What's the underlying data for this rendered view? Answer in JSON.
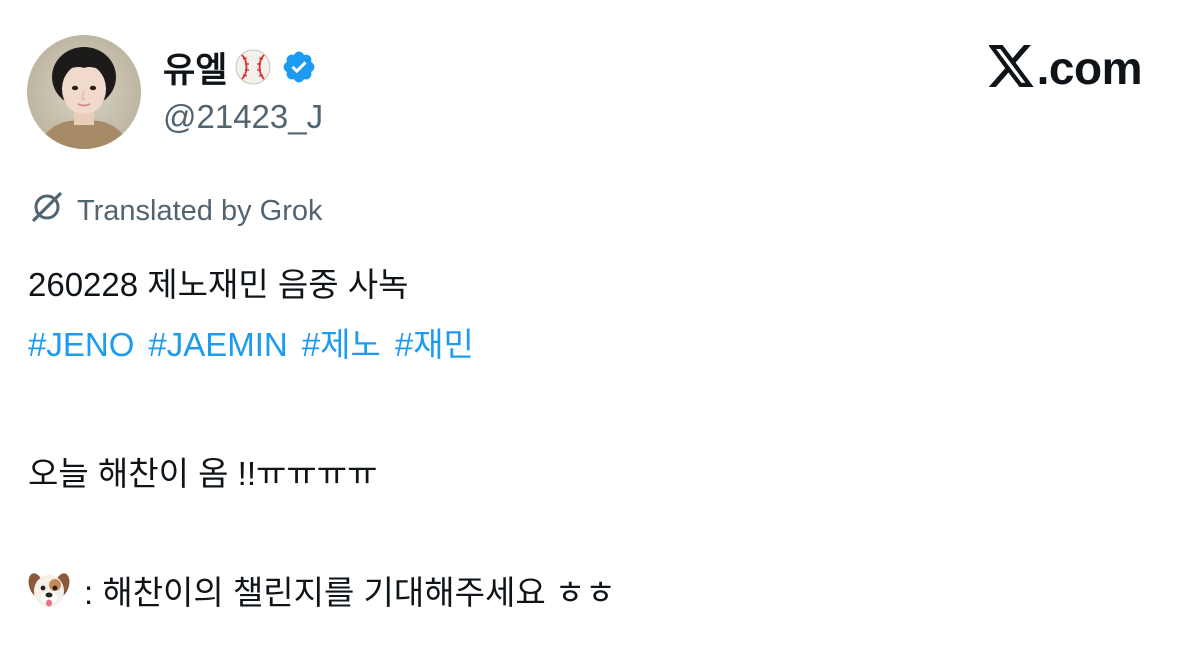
{
  "author": {
    "display_name": "유엘",
    "name_emoji": "baseball-emoji",
    "verified": true,
    "handle": "@21423_J",
    "avatar": "profile-photo"
  },
  "brand": {
    "logo_text": ".com",
    "logo_icon": "x-logo-icon"
  },
  "translation": {
    "label": "Translated by Grok",
    "icon": "grok-icon"
  },
  "post": {
    "line1": "260228 제노재민 음중 사녹",
    "hashtags": [
      "#JENO",
      "#JAEMIN",
      "#제노",
      "#재민"
    ],
    "line3": "오늘 해찬이 옴 !!ㅠㅠㅠㅠ",
    "line4_emoji": "dog-face-emoji",
    "line4_text": ": 해찬이의 챌린지를 기대해주세요 ㅎㅎ"
  },
  "colors": {
    "text": "#0f1419",
    "secondary": "#536471",
    "link": "#1d9bf0",
    "verified": "#1d9bf0"
  }
}
